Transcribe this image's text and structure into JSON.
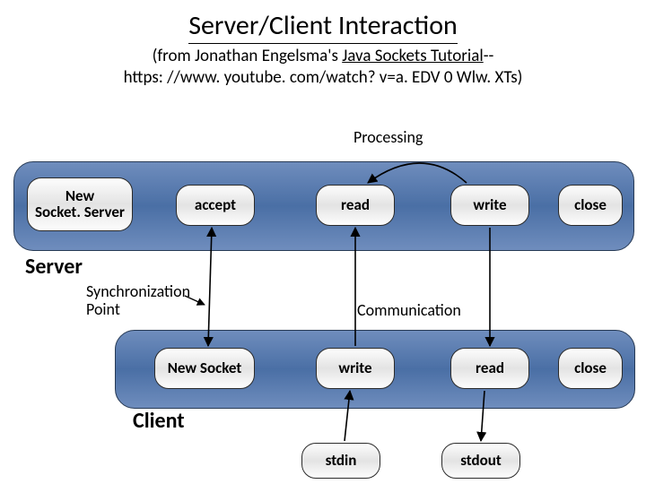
{
  "title": "Server/Client Interaction",
  "subtitle_prefix": "(from Jonathan Engelsma's ",
  "subtitle_link": "Java Sockets Tutorial",
  "subtitle_dashes": "--",
  "subtitle_url": "https: //www. youtube. com/watch? v=a. EDV 0 Wlw. XTs)",
  "labels": {
    "processing": "Processing",
    "server": "Server",
    "sync": "Synchronization\nPoint",
    "communication": "Communication",
    "client": "Client"
  },
  "server_steps": {
    "new_socket_server": "New\nSocket. Server",
    "accept": "accept",
    "read": "read",
    "write": "write",
    "close": "close"
  },
  "client_steps": {
    "new_socket": "New Socket",
    "write": "write",
    "read": "read",
    "close": "close"
  },
  "io": {
    "stdin": "stdin",
    "stdout": "stdout"
  }
}
